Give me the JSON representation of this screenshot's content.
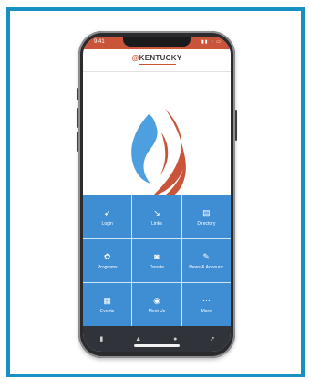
{
  "status_bar": {
    "time": "9:41",
    "icons": "▮▮ ◔ ▭"
  },
  "header": {
    "logo_prefix": "@",
    "logo_main": "KENTUCKY"
  },
  "tiles": [
    {
      "label": "Login",
      "icon": "➶",
      "icon_name": "login-icon"
    },
    {
      "label": "Links",
      "icon": "↘",
      "icon_name": "link-icon"
    },
    {
      "label": "Directory",
      "icon": "▤",
      "icon_name": "directory-icon"
    },
    {
      "label": "Programs",
      "icon": "✿",
      "icon_name": "programs-icon"
    },
    {
      "label": "Donate",
      "icon": "◙",
      "icon_name": "donate-icon"
    },
    {
      "label": "News & Announc",
      "icon": "✎",
      "icon_name": "news-icon"
    },
    {
      "label": "Events",
      "icon": "▦",
      "icon_name": "events-icon"
    },
    {
      "label": "Meet Us",
      "icon": "◉",
      "icon_name": "meet-us-icon"
    },
    {
      "label": "More",
      "icon": "⋯",
      "icon_name": "more-icon"
    }
  ],
  "bottom_nav": [
    {
      "icon": "▮",
      "icon_name": "menu-icon"
    },
    {
      "icon": "▲",
      "icon_name": "notification-icon"
    },
    {
      "icon": "●",
      "icon_name": "home-icon"
    },
    {
      "icon": "➚",
      "icon_name": "share-icon"
    }
  ],
  "colors": {
    "border": "#1790c2",
    "accent_red": "#c9543a",
    "tile_blue": "#3f8ed3",
    "flame_blue": "#4d9fe0"
  }
}
